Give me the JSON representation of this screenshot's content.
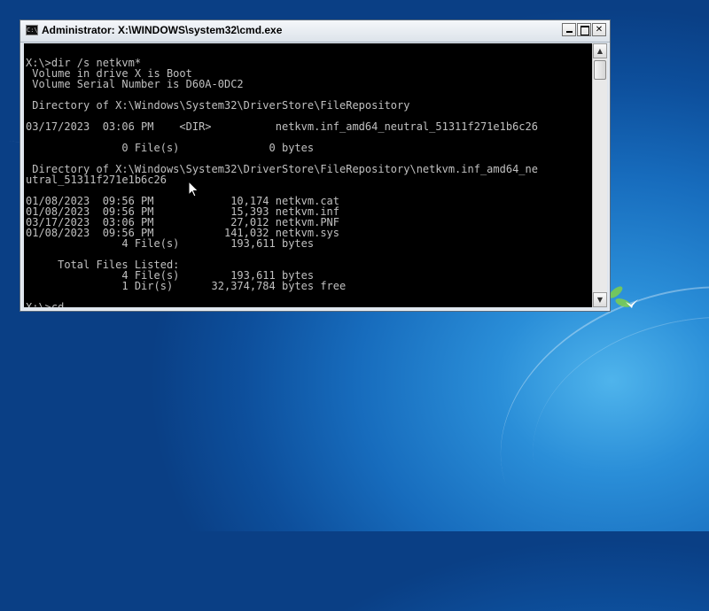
{
  "window": {
    "title": "Administrator: X:\\WINDOWS\\system32\\cmd.exe",
    "icon": "cmd-icon",
    "controls": [
      "minimize-icon",
      "maximize-icon",
      "close-icon"
    ],
    "close_glyph": "✕"
  },
  "console": {
    "lines": [
      "",
      "X:\\>dir /s netkvm*",
      " Volume in drive X is Boot",
      " Volume Serial Number is D60A-0DC2",
      "",
      " Directory of X:\\Windows\\System32\\DriverStore\\FileRepository",
      "",
      "03/17/2023  03:06 PM    <DIR>          netkvm.inf_amd64_neutral_51311f271e1b6c26",
      "",
      "               0 File(s)              0 bytes",
      "",
      " Directory of X:\\Windows\\System32\\DriverStore\\FileRepository\\netkvm.inf_amd64_ne",
      "utral_51311f271e1b6c26",
      "",
      "01/08/2023  09:56 PM            10,174 netkvm.cat",
      "01/08/2023  09:56 PM            15,393 netkvm.inf",
      "03/17/2023  03:06 PM            27,012 netkvm.PNF",
      "01/08/2023  09:56 PM           141,032 netkvm.sys",
      "               4 File(s)        193,611 bytes",
      "",
      "     Total Files Listed:",
      "               4 File(s)        193,611 bytes",
      "               1 Dir(s)      32,374,784 bytes free",
      "",
      "X:\\>cd"
    ],
    "text_color": "#c0c0c0",
    "background": "#000000"
  },
  "scrollbar": {
    "up_glyph": "▲",
    "down_glyph": "▼"
  },
  "desktop": {
    "background": "#176cbd"
  }
}
